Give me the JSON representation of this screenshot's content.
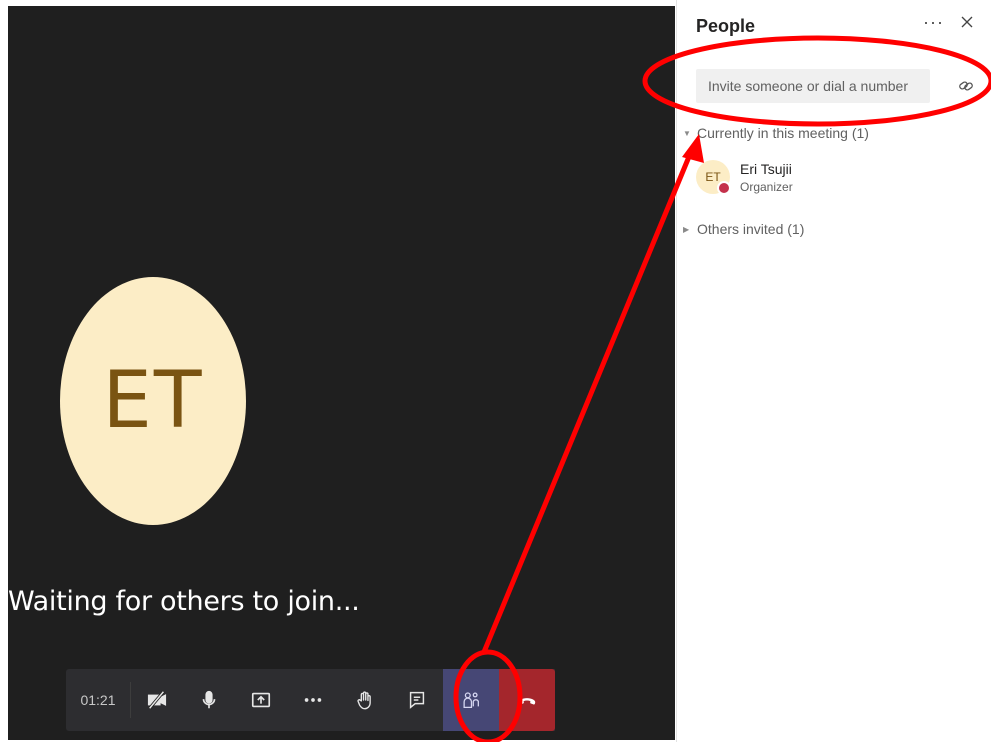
{
  "stage": {
    "avatar_initials": "ET",
    "waiting_text": "Waiting for others to join..."
  },
  "toolbar": {
    "call_time": "01:21",
    "icons": [
      "video-off-icon",
      "microphone-icon",
      "share-screen-icon",
      "more-icon",
      "raise-hand-icon",
      "chat-icon",
      "people-icon",
      "hang-up-icon"
    ]
  },
  "panel": {
    "title": "People",
    "more_label": "···",
    "invite_placeholder": "Invite someone or dial a number",
    "current_section": "Currently in this meeting (1)",
    "others_section": "Others invited (1)",
    "participants": [
      {
        "initials": "ET",
        "name": "Eri Tsujii",
        "role": "Organizer"
      }
    ]
  },
  "colors": {
    "stage_bg": "#1f1f1f",
    "avatar_bg": "#fcedc6",
    "avatar_text": "#7a5412",
    "people_active": "#464775",
    "hang_up": "#a4262c",
    "annotation": "#ff0000",
    "status_busy": "#c4314b"
  }
}
